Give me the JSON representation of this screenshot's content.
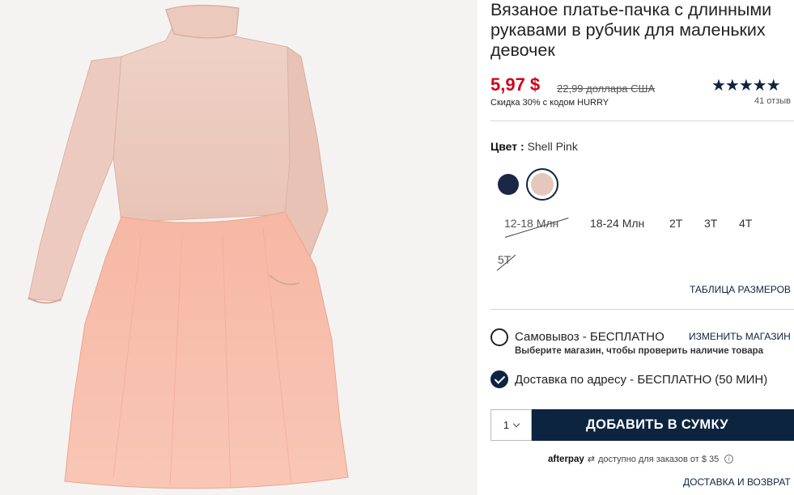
{
  "product": {
    "title_line1": "Вязаное платье-пачка с длинными",
    "title_line2": "рукавами в рубчик для маленьких",
    "title_line3": "девочек",
    "price": "5,97 $",
    "old_price": "22,99 доллара США",
    "discount": "Скидка 30% с кодом HURRY",
    "rating_stars": "★★★★★",
    "reviews": "41 отзыв"
  },
  "color": {
    "label": "Цвет :",
    "selected": "Shell Pink",
    "swatches": [
      {
        "name": "navy",
        "hex": "#1b2744"
      },
      {
        "name": "shell-pink",
        "hex": "#e6c7bb",
        "selected": true
      }
    ]
  },
  "sizes": [
    {
      "label": "12-18 Млн",
      "available": false
    },
    {
      "label": "18-24 Млн",
      "available": true
    },
    {
      "label": "2T",
      "available": true
    },
    {
      "label": "3T",
      "available": true
    },
    {
      "label": "4T",
      "available": true
    },
    {
      "label": "5T",
      "available": false
    }
  ],
  "size_chart_link": "ТАБЛИЦА РАЗМЕРОВ",
  "fulfillment": {
    "pickup_label": "Самовывоз - БЕСПЛАТНО",
    "change_store_link": "ИЗМЕНИТЬ МАГАЗИН",
    "pickup_sub": "Выберите магазин, чтобы проверить наличие товара",
    "shipping_label": "Доставка по адресу - БЕСПЛАТНО (50 МИН)"
  },
  "cart": {
    "quantity": "1",
    "add_button": "ДОБАВИТЬ В СУМКУ"
  },
  "afterpay": {
    "logo": "afterpay",
    "text": "доступно для заказов от $ 35",
    "info": "i"
  },
  "returns_link": "ДОСТАВКА И ВОЗВРАТ",
  "colors": {
    "accent": "#0d2441",
    "sale": "#d0021b"
  }
}
